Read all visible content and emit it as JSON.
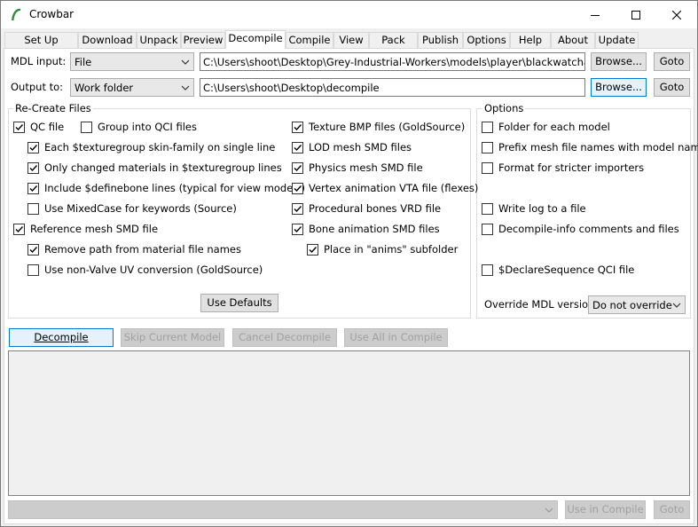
{
  "window": {
    "title": "Crowbar"
  },
  "tabs": [
    "Set Up Games",
    "Download",
    "Unpack",
    "Preview",
    "Decompile",
    "Compile",
    "View",
    "Pack",
    "Publish",
    "Options",
    "Help",
    "About",
    "Update"
  ],
  "active_tab": "Decompile",
  "mdl_input": {
    "label": "MDL input:",
    "mode": "File",
    "path": "C:\\Users\\shoot\\Desktop\\Grey-Industrial-Workers\\models\\player\\blackwatcharmy_gi",
    "browse": "Browse...",
    "goto": "Goto"
  },
  "output_to": {
    "label": "Output to:",
    "mode": "Work folder",
    "path": "C:\\Users\\shoot\\Desktop\\decompile",
    "browse": "Browse...",
    "goto": "Goto"
  },
  "recreate": {
    "title": "Re-Create Files",
    "col1": [
      {
        "label": "QC file",
        "checked": true
      },
      {
        "label": "Group into QCI files",
        "checked": false
      },
      {
        "label": "Each $texturegroup skin-family on single line",
        "checked": true
      },
      {
        "label": "Only changed materials in $texturegroup lines",
        "checked": true
      },
      {
        "label": "Include $definebone lines (typical for view models)",
        "checked": true
      },
      {
        "label": "Use MixedCase for keywords (Source)",
        "checked": false
      },
      {
        "label": "Reference mesh SMD file",
        "checked": true
      },
      {
        "label": "Remove path from material file names",
        "checked": true
      },
      {
        "label": "Use non-Valve UV conversion (GoldSource)",
        "checked": false
      }
    ],
    "col2": [
      {
        "label": "Texture BMP files (GoldSource)",
        "checked": true
      },
      {
        "label": "LOD mesh SMD files",
        "checked": true
      },
      {
        "label": "Physics mesh SMD file",
        "checked": true
      },
      {
        "label": "Vertex animation VTA file (flexes)",
        "checked": true
      },
      {
        "label": "Procedural bones VRD file",
        "checked": true
      },
      {
        "label": "Bone animation SMD files",
        "checked": true
      },
      {
        "label": "Place in \"anims\" subfolder",
        "checked": true
      }
    ],
    "use_defaults": "Use Defaults"
  },
  "options": {
    "title": "Options",
    "items": [
      {
        "label": "Folder for each model",
        "checked": false
      },
      {
        "label": "Prefix mesh file names with model name",
        "checked": false
      },
      {
        "label": "Format for stricter importers",
        "checked": false
      },
      {
        "label": "Write log to a file",
        "checked": false
      },
      {
        "label": "Decompile-info comments and files",
        "checked": false
      },
      {
        "label": "$DeclareSequence QCI file",
        "checked": false
      }
    ],
    "override_label": "Override MDL version:",
    "override_value": "Do not override"
  },
  "actions": {
    "decompile": "Decompile",
    "skip": "Skip Current Model",
    "cancel": "Cancel Decompile",
    "use_all": "Use All in Compile"
  },
  "bottom": {
    "use_in_compile": "Use in Compile",
    "goto": "Goto"
  }
}
